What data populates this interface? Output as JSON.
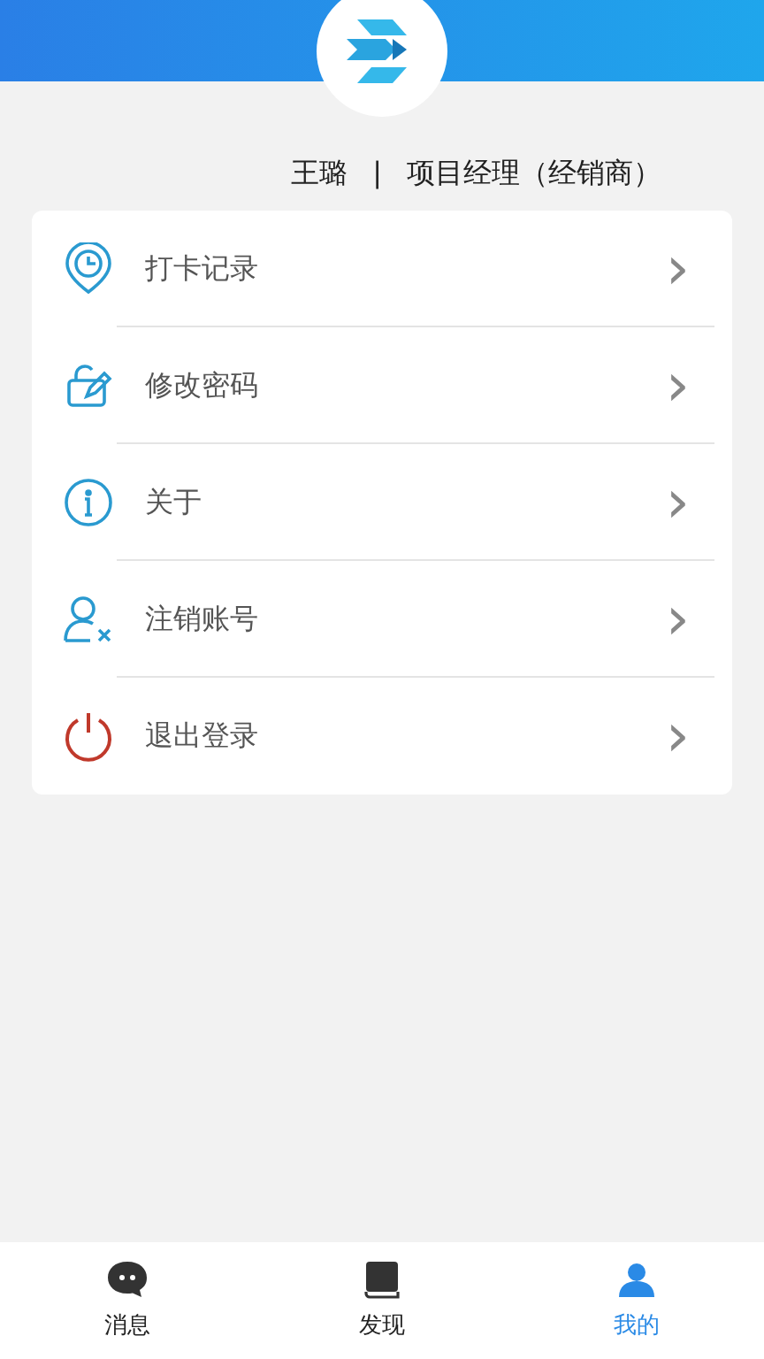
{
  "profile": {
    "name": "王璐",
    "separator": "|",
    "role": "项目经理（经销商）"
  },
  "menu": [
    {
      "kind": "clock",
      "label": "打卡记录",
      "arrow": "›"
    },
    {
      "kind": "edit",
      "label": "修改密码",
      "arrow": "›"
    },
    {
      "kind": "info",
      "label": "关于",
      "arrow": "›"
    },
    {
      "kind": "user-remove",
      "label": "注销账号",
      "arrow": "›"
    },
    {
      "kind": "power",
      "label": "退出登录",
      "arrow": "›"
    }
  ],
  "tabs": [
    {
      "kind": "chat",
      "label": "消息",
      "selected": false
    },
    {
      "kind": "book",
      "label": "发现",
      "selected": false
    },
    {
      "kind": "user",
      "label": "我的",
      "selected": true
    }
  ]
}
